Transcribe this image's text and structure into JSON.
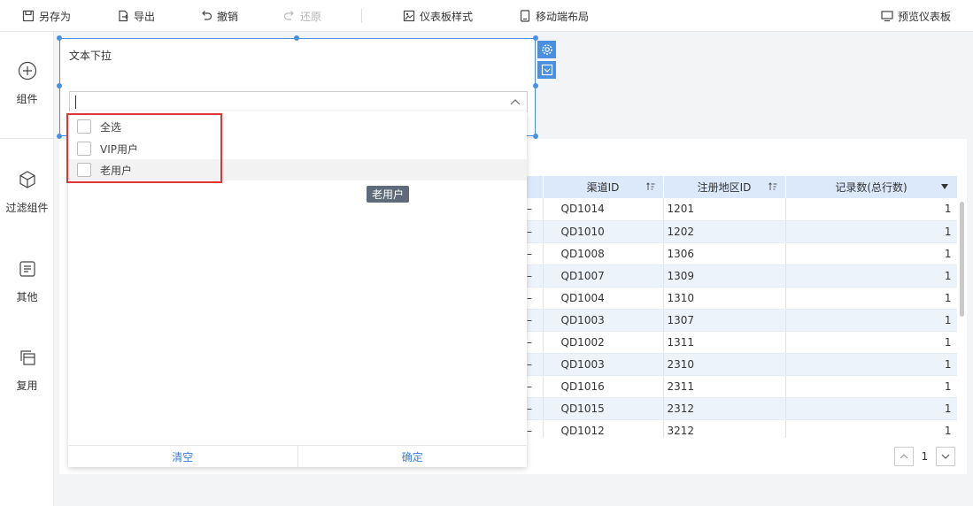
{
  "toolbar": {
    "save_as": "另存为",
    "export": "导出",
    "undo": "撤销",
    "redo": "还原",
    "dashboard_style": "仪表板样式",
    "mobile_layout": "移动端布局",
    "preview": "预览仪表板"
  },
  "sidebar": {
    "items": [
      {
        "label": "组件",
        "icon": "plus-circle-icon"
      },
      {
        "label": "过滤组件",
        "icon": "cube-icon"
      },
      {
        "label": "其他",
        "icon": "document-icon"
      },
      {
        "label": "复用",
        "icon": "copy-icon"
      }
    ]
  },
  "filter_widget": {
    "title": "文本下拉",
    "input_value": "",
    "options": [
      "全选",
      "VIP用户",
      "老用户"
    ],
    "clear_label": "清空",
    "confirm_label": "确定",
    "tooltip": "老用户"
  },
  "table": {
    "columns": [
      "渠道ID",
      "注册地区ID",
      "记录数(总行数)"
    ],
    "rows": [
      [
        "QD1014",
        "1201",
        "1"
      ],
      [
        "QD1010",
        "1202",
        "1"
      ],
      [
        "QD1008",
        "1306",
        "1"
      ],
      [
        "QD1007",
        "1309",
        "1"
      ],
      [
        "QD1004",
        "1310",
        "1"
      ],
      [
        "QD1003",
        "1307",
        "1"
      ],
      [
        "QD1002",
        "1311",
        "1"
      ],
      [
        "QD1003",
        "2310",
        "1"
      ],
      [
        "QD1016",
        "2311",
        "1"
      ],
      [
        "QD1015",
        "2312",
        "1"
      ],
      [
        "QD1012",
        "3212",
        "1"
      ]
    ]
  },
  "pager": {
    "page": "1"
  },
  "colors": {
    "accent": "#4a90e2",
    "header_bg": "#dbe9fb",
    "highlight": "#e03535"
  }
}
